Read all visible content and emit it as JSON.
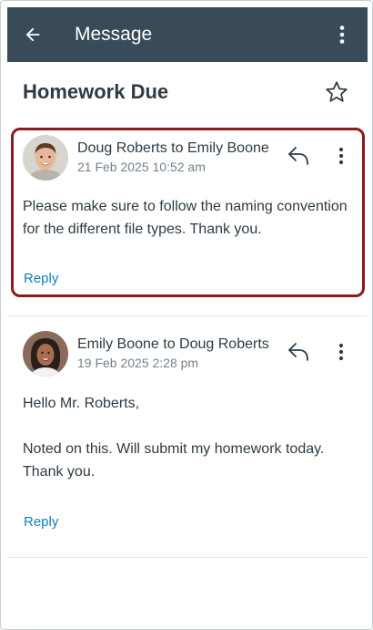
{
  "toolbar": {
    "title": "Message",
    "back_icon": "arrow-left-icon",
    "more_icon": "kebab-vertical-icon",
    "background": "#394b58"
  },
  "conversation": {
    "subject": "Homework Due",
    "star_icon": "star-outline-icon"
  },
  "messages": [
    {
      "participants": "Doug Roberts to Emily Boone",
      "date": "21 Feb 2025 10:52 am",
      "body": [
        "Please make sure to follow the naming convention",
        "for the different file types. Thank you."
      ],
      "reply_label": "Reply",
      "highlighted": true
    },
    {
      "participants": "Emily Boone to Doug Roberts",
      "date": "19 Feb 2025 2:28 pm",
      "body": [
        "Hello Mr. Roberts,",
        "",
        "Noted on this. Will submit my homework today.",
        "Thank you."
      ],
      "reply_label": "Reply",
      "highlighted": false
    }
  ],
  "colors": {
    "link": "#127fb8",
    "highlight_border": "#8b1a1a",
    "text": "#2d3b45",
    "secondary_text": "#73818c"
  }
}
